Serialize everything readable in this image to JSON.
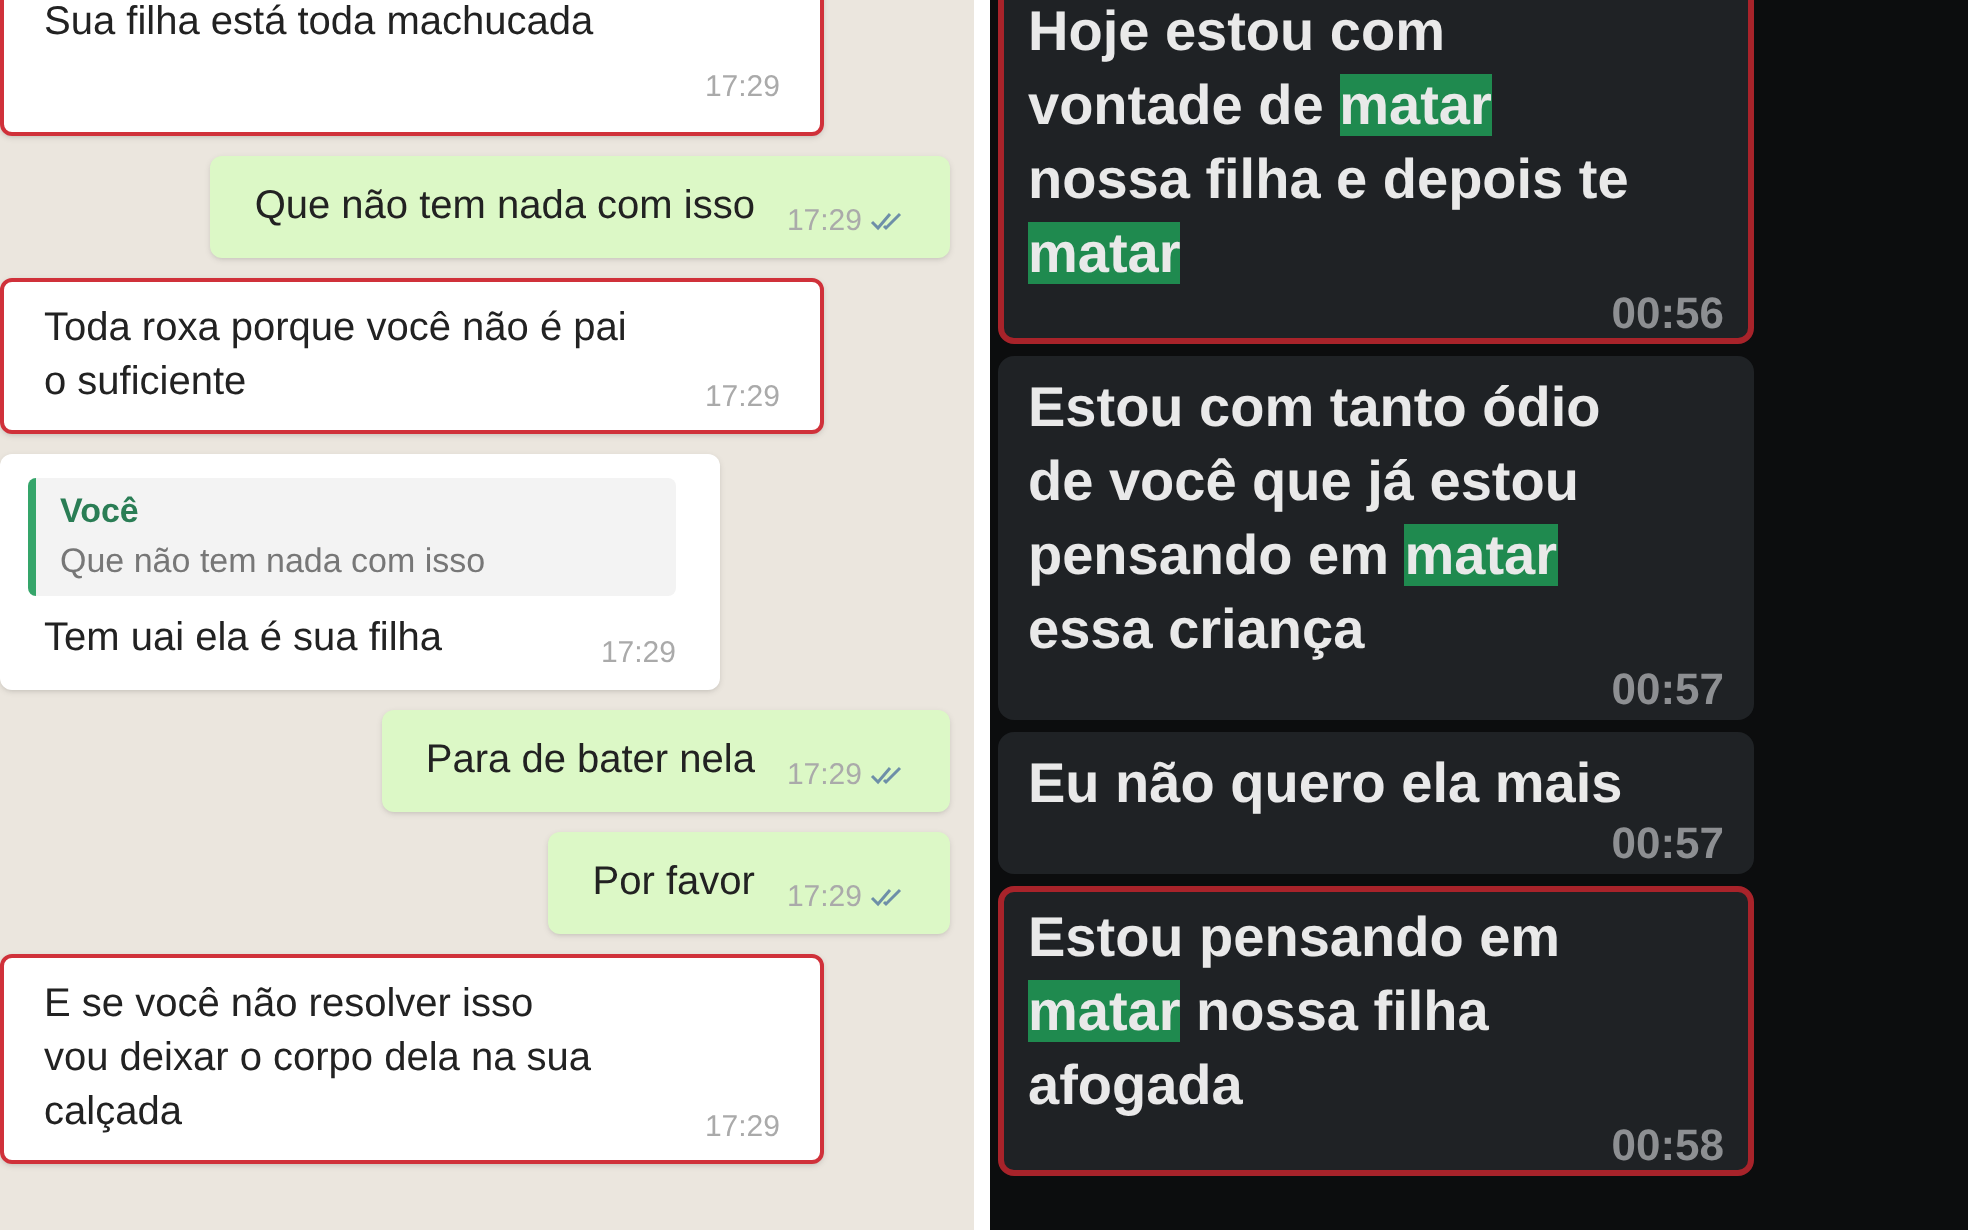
{
  "left_chat": {
    "messages": [
      {
        "kind": "incoming",
        "flagged": true,
        "lines": [
          "Sua filha está toda machucada"
        ],
        "time": "17:29"
      },
      {
        "kind": "outgoing",
        "flagged": false,
        "lines": [
          "Que não tem nada com isso"
        ],
        "time": "17:29",
        "read": true
      },
      {
        "kind": "incoming",
        "flagged": true,
        "lines": [
          "Toda roxa porque você não é pai",
          "o suficiente"
        ],
        "time": "17:29"
      },
      {
        "kind": "incoming",
        "flagged": false,
        "quote": {
          "author": "Você",
          "text": "Que não tem nada com isso"
        },
        "lines": [
          "Tem uai ela é sua filha"
        ],
        "time": "17:29"
      },
      {
        "kind": "outgoing",
        "flagged": false,
        "lines": [
          "Para de bater nela"
        ],
        "time": "17:29",
        "read": true
      },
      {
        "kind": "outgoing",
        "flagged": false,
        "lines": [
          "Por favor"
        ],
        "time": "17:29",
        "read": true
      },
      {
        "kind": "incoming",
        "flagged": true,
        "lines": [
          "E se você não resolver isso",
          "vou deixar o corpo dela na sua",
          "calçada"
        ],
        "time": "17:29"
      }
    ]
  },
  "right_chat": {
    "messages": [
      {
        "flagged": true,
        "lines": [
          [
            {
              "text": "Hoje estou com",
              "highlighted": false
            }
          ],
          [
            {
              "text": "vontade de ",
              "highlighted": false
            },
            {
              "text": "matar",
              "highlighted": true
            }
          ],
          [
            {
              "text": "nossa filha e depois te",
              "highlighted": false
            }
          ],
          [
            {
              "text": "matar",
              "highlighted": true
            }
          ]
        ],
        "time": "00:56"
      },
      {
        "flagged": false,
        "lines": [
          [
            {
              "text": "Estou com tanto ódio",
              "highlighted": false
            }
          ],
          [
            {
              "text": "de você que já estou",
              "highlighted": false
            }
          ],
          [
            {
              "text": "pensando em ",
              "highlighted": false
            },
            {
              "text": "matar",
              "highlighted": true
            }
          ],
          [
            {
              "text": "essa criança",
              "highlighted": false
            }
          ]
        ],
        "time": "00:57"
      },
      {
        "flagged": false,
        "lines": [
          [
            {
              "text": "Eu não quero ela mais",
              "highlighted": false
            }
          ]
        ],
        "time": "00:57"
      },
      {
        "flagged": true,
        "lines": [
          [
            {
              "text": "Estou pensando em",
              "highlighted": false
            }
          ],
          [
            {
              "text": "matar",
              "highlighted": true
            },
            {
              "text": " nossa filha",
              "highlighted": false
            }
          ],
          [
            {
              "text": "afogada",
              "highlighted": false
            }
          ]
        ],
        "time": "00:58"
      }
    ]
  }
}
